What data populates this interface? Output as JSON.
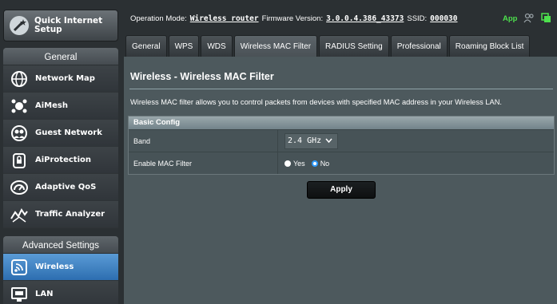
{
  "sidebar": {
    "qis_label": "Quick Internet Setup",
    "general_header": "General",
    "general_items": [
      {
        "label": "Network Map",
        "icon": "network-map-icon"
      },
      {
        "label": "AiMesh",
        "icon": "aimesh-icon"
      },
      {
        "label": "Guest Network",
        "icon": "guest-network-icon"
      },
      {
        "label": "AiProtection",
        "icon": "aiprotection-icon"
      },
      {
        "label": "Adaptive QoS",
        "icon": "adaptive-qos-icon"
      },
      {
        "label": "Traffic Analyzer",
        "icon": "traffic-analyzer-icon"
      }
    ],
    "advanced_header": "Advanced Settings",
    "advanced_items": [
      {
        "label": "Wireless",
        "icon": "wireless-icon",
        "active": true
      },
      {
        "label": "LAN",
        "icon": "lan-icon"
      }
    ]
  },
  "topbar": {
    "op_mode_label": "Operation Mode:",
    "op_mode_value": "Wireless router",
    "fw_label": "Firmware Version:",
    "fw_value": "3.0.0.4.386_43373",
    "ssid_label": "SSID:",
    "ssid_value": "000030",
    "app_label": "App"
  },
  "tabs": [
    {
      "label": "General"
    },
    {
      "label": "WPS"
    },
    {
      "label": "WDS"
    },
    {
      "label": "Wireless MAC Filter",
      "active": true
    },
    {
      "label": "RADIUS Setting"
    },
    {
      "label": "Professional"
    },
    {
      "label": "Roaming Block List"
    }
  ],
  "main": {
    "title": "Wireless - Wireless MAC Filter",
    "description": "Wireless MAC filter allows you to control packets from devices with specified MAC address in your Wireless LAN.",
    "config": {
      "header": "Basic Config",
      "band_label": "Band",
      "band_value": "2.4 GHz",
      "enable_label": "Enable MAC Filter",
      "yes_label": "Yes",
      "no_label": "No",
      "selected": "No"
    },
    "apply_label": "Apply"
  },
  "colors": {
    "accent": "#2f9bff",
    "app_green": "#4de04d",
    "active_menu": "#3f86c9"
  }
}
